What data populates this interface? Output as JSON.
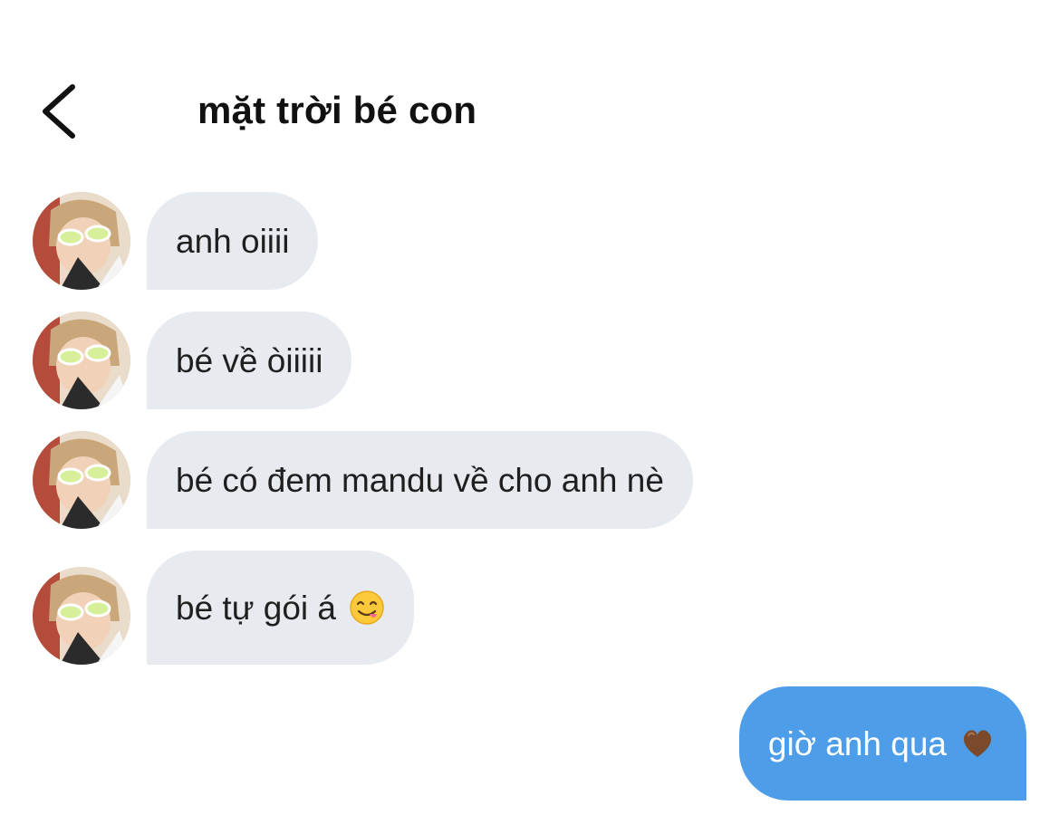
{
  "header": {
    "title": "mặt trời bé con",
    "back_icon": "chevron-left-icon"
  },
  "messages": [
    {
      "direction": "incoming",
      "text": "anh oiiii",
      "avatar": "contact-avatar"
    },
    {
      "direction": "incoming",
      "text": "bé về òiiiii",
      "avatar": "contact-avatar"
    },
    {
      "direction": "incoming",
      "text": "bé có đem mandu về cho anh nè",
      "avatar": "contact-avatar"
    },
    {
      "direction": "incoming",
      "text": "bé tự gói á",
      "emoji": "face-savoring-food-emoji",
      "avatar": "contact-avatar"
    },
    {
      "direction": "outgoing",
      "text": "giờ anh qua",
      "emoji": "brown-heart-emoji"
    }
  ],
  "colors": {
    "incoming_bubble": "#e7ebf0",
    "outgoing_bubble": "#4e9de9",
    "outgoing_text": "#ffffff"
  }
}
